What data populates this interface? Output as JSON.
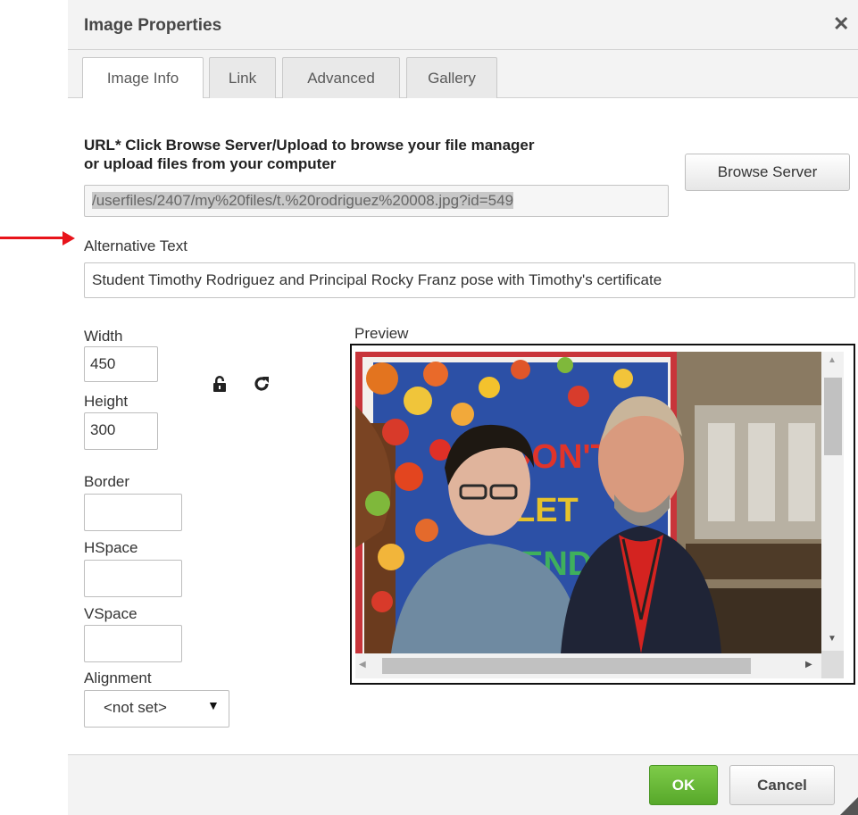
{
  "dialog": {
    "title": "Image Properties",
    "close_glyph": "✕"
  },
  "tabs": [
    {
      "label": "Image Info",
      "active": true
    },
    {
      "label": "Link",
      "active": false
    },
    {
      "label": "Advanced",
      "active": false
    },
    {
      "label": "Gallery",
      "active": false
    }
  ],
  "url": {
    "label_line1": "URL* Click Browse Server/Upload to browse your file manager",
    "label_line2": "or upload files from your computer",
    "value": "/userfiles/2407/my%20files/t.%20rodriguez%20008.jpg?id=549",
    "browse_label": "Browse Server"
  },
  "alt_text": {
    "label": "Alternative Text",
    "value": "Student Timothy Rodriguez and Principal Rocky Franz pose with Timothy's certificate"
  },
  "dimensions": {
    "width_label": "Width",
    "width_value": "450",
    "height_label": "Height",
    "height_value": "300",
    "lock_icon": "lock-icon",
    "reset_icon": "reset-size-icon"
  },
  "spacing": {
    "border_label": "Border",
    "border_value": "",
    "hspace_label": "HSpace",
    "hspace_value": "",
    "vspace_label": "VSpace",
    "vspace_value": ""
  },
  "alignment": {
    "label": "Alignment",
    "selected": "<not set>"
  },
  "preview": {
    "label": "Preview",
    "poster_text_1": "DON'T",
    "poster_text_2": "LET",
    "poster_text_3": "END"
  },
  "footer": {
    "ok_label": "OK",
    "cancel_label": "Cancel"
  },
  "colors": {
    "ok_green": "#6cbb3c",
    "annotation_arrow": "#e8141b"
  }
}
